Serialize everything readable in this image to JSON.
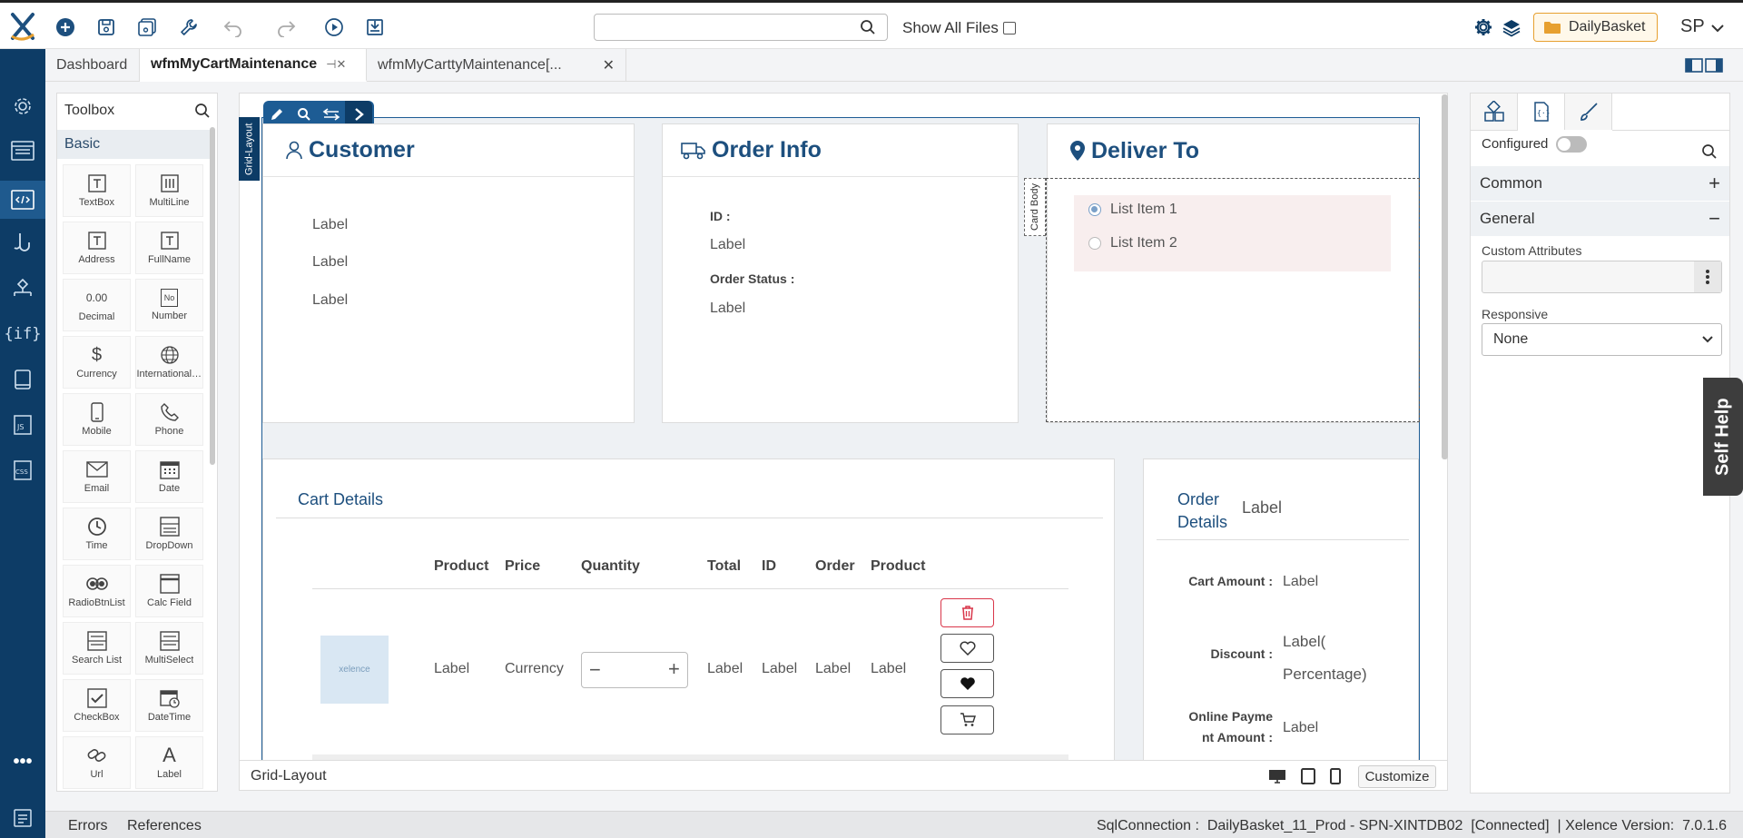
{
  "app": {
    "logo": "X"
  },
  "top": {
    "search_placeholder": "",
    "show_all_files": "Show All Files",
    "db_name": "DailyBasket",
    "user_initials": "SP"
  },
  "tabs": [
    {
      "label": "Dashboard"
    },
    {
      "label": "wfmMyCartMaintenance"
    },
    {
      "label": "wfmMyCarttyMaintenance[..."
    }
  ],
  "toolbox": {
    "title": "Toolbox",
    "section": "Basic",
    "tools": [
      {
        "label": "TextBox",
        "icon": "textbox-icon"
      },
      {
        "label": "MultiLine",
        "icon": "multiline-icon"
      },
      {
        "label": "Address",
        "icon": "address-icon"
      },
      {
        "label": "FullName",
        "icon": "fullname-icon"
      },
      {
        "label": "Decimal",
        "icon": "decimal-icon",
        "glyph": "0.00"
      },
      {
        "label": "Number",
        "icon": "number-icon",
        "glyph": "No"
      },
      {
        "label": "Currency",
        "icon": "currency-icon",
        "glyph": "$"
      },
      {
        "label": "International ...",
        "icon": "globe-icon"
      },
      {
        "label": "Mobile",
        "icon": "mobile-icon"
      },
      {
        "label": "Phone",
        "icon": "phone-icon"
      },
      {
        "label": "Email",
        "icon": "email-icon"
      },
      {
        "label": "Date",
        "icon": "date-icon"
      },
      {
        "label": "Time",
        "icon": "time-icon"
      },
      {
        "label": "DropDown",
        "icon": "dropdown-icon"
      },
      {
        "label": "RadioBtnList",
        "icon": "radio-list-icon"
      },
      {
        "label": "Calc Field",
        "icon": "calc-field-icon"
      },
      {
        "label": "Search List",
        "icon": "search-list-icon"
      },
      {
        "label": "MultiSelect",
        "icon": "multiselect-icon"
      },
      {
        "label": "CheckBox",
        "icon": "checkbox-icon"
      },
      {
        "label": "DateTime",
        "icon": "datetime-icon"
      },
      {
        "label": "Url",
        "icon": "url-icon"
      },
      {
        "label": "Label",
        "icon": "label-icon",
        "glyph": "A"
      }
    ]
  },
  "canvas": {
    "grid_layout_tag": "Grid-Layout",
    "customer": {
      "title": "Customer",
      "labels": [
        "Label",
        "Label",
        "Label"
      ]
    },
    "order_info": {
      "title": "Order Info",
      "id_label": "ID :",
      "id_value": "Label",
      "status_label": "Order Status :",
      "status_value": "Label"
    },
    "deliver_to": {
      "title": "Deliver To",
      "card_body_tag": "Card Body",
      "items": [
        "List Item 1",
        "List Item 2"
      ]
    },
    "cart": {
      "title": "Cart Details",
      "headers": [
        "Product",
        "Price",
        "Quantity",
        "Total",
        "ID",
        "Order",
        "Product"
      ],
      "row": {
        "logo_text": "xelence",
        "product": "Label",
        "price": "Currency",
        "qty_minus": "−",
        "qty_plus": "+",
        "total": "Label",
        "id": "Label",
        "order": "Label",
        "product2": "Label"
      }
    },
    "order_details": {
      "title_line1": "Order",
      "title_line2": "Details",
      "title_value": "Label",
      "cart_amount_label": "Cart Amount :",
      "cart_amount_value": "Label",
      "discount_label": "Discount :",
      "discount_value_line1": "Label(",
      "discount_value_line2": "Percentage)",
      "online_label_line1": "Online Payme",
      "online_label_line2": "nt Amount :",
      "online_value": "Label"
    },
    "footer_label": "Grid-Layout",
    "customize": "Customize"
  },
  "right_panel": {
    "configured": "Configured",
    "common": "Common",
    "common_sign": "+",
    "general": "General",
    "general_sign": "−",
    "custom_attributes": "Custom Attributes",
    "responsive": "Responsive",
    "responsive_value": "None"
  },
  "self_help": "Self Help",
  "status": {
    "errors": "Errors",
    "references": "References",
    "connection": "SqlConnection :  DailyBasket_11_Prod - SPN-XINTDB02  [Connected]  | Xelence Version:  7.0.1.6"
  },
  "colors": {
    "primary": "#0d3c66",
    "accent": "#1d5c94",
    "db_border": "#e7a030",
    "delete": "#d9364a"
  }
}
